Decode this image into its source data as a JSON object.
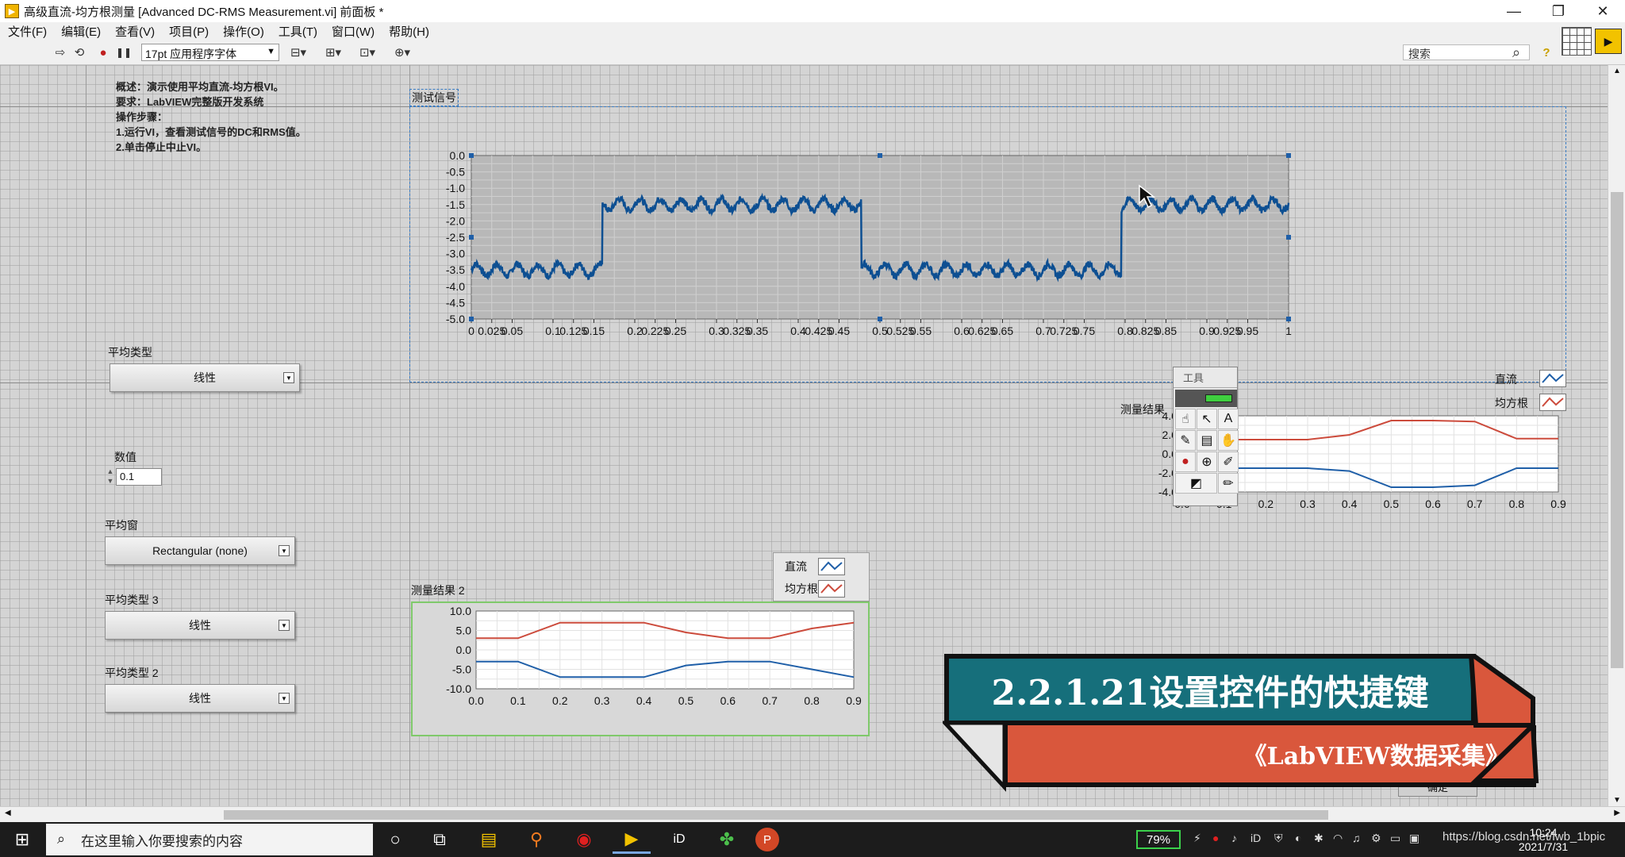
{
  "window": {
    "title": "高级直流-均方根测量 [Advanced DC-RMS Measurement.vi] 前面板 *",
    "min_glyph": "—",
    "max_glyph": "❐",
    "close_glyph": "✕"
  },
  "menubar": {
    "items": [
      "文件(F)",
      "编辑(E)",
      "查看(V)",
      "项目(P)",
      "操作(O)",
      "工具(T)",
      "窗口(W)",
      "帮助(H)"
    ]
  },
  "toolbar": {
    "font_select_value": "17pt 应用程序字体",
    "search_placeholder": "搜索",
    "run_glyph": "⇨",
    "run_cont_glyph": "⟲",
    "abort_glyph": "●",
    "pause_glyph": "❚❚",
    "align_glyph": "⊟▾",
    "distribute_glyph": "⊞▾",
    "resize_glyph": "⊡▾",
    "reorder_glyph": "⊕▾",
    "search_glyph": "⌕",
    "help_glyph": "?"
  },
  "description": {
    "lines": [
      "概述：演示使用平均直流-均方根VI。",
      "要求：LabVIEW完整版开发系统",
      "操作步骤：",
      "1.运行VI，查看测试信号的DC和RMS值。",
      "2.单击停止中止VI。"
    ]
  },
  "controls": {
    "averaging_type": {
      "label": "平均类型",
      "value": "线性"
    },
    "numeric": {
      "label": "数值",
      "value": "0.1"
    },
    "averaging_window": {
      "label": "平均窗",
      "value": "Rectangular (none)"
    },
    "averaging_type_3": {
      "label": "平均类型 3",
      "value": "线性"
    },
    "averaging_type_2": {
      "label": "平均类型 2",
      "value": "线性"
    }
  },
  "graphs": {
    "test_signal": {
      "label": "测试信号"
    },
    "results": {
      "label": "测量结果"
    },
    "results2": {
      "label": "测量结果 2"
    }
  },
  "legend": {
    "dc": "直流",
    "rms": "均方根"
  },
  "tools_palette": {
    "title": "工具"
  },
  "banner": {
    "title": "2.2.1.21设置控件的快捷键",
    "subtitle": "《LabVIEW数据采集》"
  },
  "confirm_button": "确定",
  "taskbar": {
    "search_placeholder": "在这里输入你要搜索的内容",
    "battery": "79%",
    "time": "10:24",
    "date": "2021/7/31",
    "watermark": "https://blog.csdn.net/lwb_1bpic",
    "start_glyph": "⊞",
    "search_glyph": "⌕",
    "apps": [
      "○",
      "⧉",
      "▤",
      "⚲",
      "◉",
      "▶",
      "iD",
      "✤",
      "P"
    ]
  },
  "colors": {
    "dc": "#1f5fa8",
    "rms": "#cc4b3c",
    "square": "#0d4f92",
    "banner_top": "#166f7b",
    "banner_bottom": "#d9573c"
  },
  "chart_data": [
    {
      "type": "line",
      "title": "测试信号",
      "x_ticks": [
        "0",
        "0.025",
        "0.05",
        "0.1",
        "0.125",
        "0.15",
        "0.2",
        "0.225",
        "0.25",
        "0.3",
        "0.325",
        "0.35",
        "0.4",
        "0.425",
        "0.45",
        "0.5",
        "0.525",
        "0.55",
        "0.6",
        "0.625",
        "0.65",
        "0.7",
        "0.725",
        "0.75",
        "0.8",
        "0.825",
        "0.85",
        "0.9",
        "0.925",
        "0.95",
        "1"
      ],
      "y_ticks": [
        "0.0",
        "-0.5",
        "-1.0",
        "-1.5",
        "-2.0",
        "-2.5",
        "-3.0",
        "-3.5",
        "-4.0",
        "-4.5",
        "-5.0"
      ],
      "xlim": [
        0,
        1
      ],
      "ylim": [
        -5,
        0
      ],
      "series": [
        {
          "segments": [
            {
              "x0": 0,
              "x1": 0.16,
              "level": -3.5
            },
            {
              "x0": 0.16,
              "x1": 0.477,
              "level": -1.5
            },
            {
              "x0": 0.477,
              "x1": 0.795,
              "level": -3.5
            },
            {
              "x0": 0.795,
              "x1": 1,
              "level": -1.5
            }
          ],
          "ripple": 0.3
        }
      ]
    },
    {
      "type": "line",
      "title": "测量结果",
      "x": [
        0,
        0.1,
        0.2,
        0.3,
        0.4,
        0.5,
        0.6,
        0.7,
        0.8,
        0.9
      ],
      "x_ticks": [
        "0.0",
        "0.1",
        "0.2",
        "0.3",
        "0.4",
        "0.5",
        "0.6",
        "0.7",
        "0.8",
        "0.9"
      ],
      "y_ticks": [
        "4.0",
        "2.0",
        "0.0",
        "-2.0",
        "-4.0"
      ],
      "ylim": [
        -4,
        4
      ],
      "series": [
        {
          "name": "直流",
          "values": [
            -2.3,
            -1.5,
            -1.5,
            -1.5,
            -1.8,
            -3.5,
            -3.5,
            -3.3,
            -1.5,
            -1.5
          ]
        },
        {
          "name": "均方根",
          "values": [
            2.3,
            1.5,
            1.5,
            1.5,
            2.0,
            3.5,
            3.5,
            3.4,
            1.6,
            1.6
          ]
        }
      ]
    },
    {
      "type": "line",
      "title": "测量结果 2",
      "x": [
        0,
        0.1,
        0.2,
        0.3,
        0.4,
        0.5,
        0.6,
        0.7,
        0.8,
        0.9
      ],
      "x_ticks": [
        "0.0",
        "0.1",
        "0.2",
        "0.3",
        "0.4",
        "0.5",
        "0.6",
        "0.7",
        "0.8",
        "0.9"
      ],
      "y_ticks": [
        "10.0",
        "5.0",
        "0.0",
        "-5.0",
        "-10.0"
      ],
      "ylim": [
        -10,
        10
      ],
      "series": [
        {
          "name": "直流",
          "values": [
            -3,
            -3,
            -7,
            -7,
            -7,
            -4,
            -3,
            -3,
            -5,
            -7
          ]
        },
        {
          "name": "均方根",
          "values": [
            3,
            3,
            7,
            7,
            7,
            4.5,
            3,
            3,
            5.5,
            7
          ]
        }
      ]
    }
  ]
}
